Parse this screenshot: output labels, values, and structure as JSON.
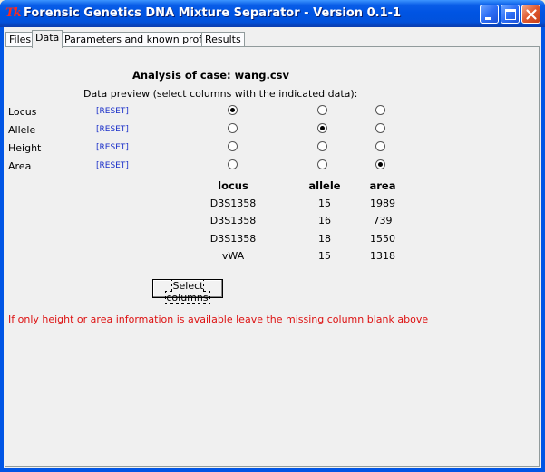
{
  "window": {
    "icon_text": "Tk",
    "title": "Forensic Genetics DNA Mixture Separator - Version 0.1-1"
  },
  "tabs": [
    {
      "label": "Files",
      "active": false
    },
    {
      "label": "Data",
      "active": true
    },
    {
      "label": "Parameters and known profiles",
      "active": false
    },
    {
      "label": "Results",
      "active": false
    }
  ],
  "data_tab": {
    "case_title": "Analysis of case: wang.csv",
    "preview_label": "Data preview (select columns with the indicated data):",
    "reset_label": "[RESET]",
    "rows": [
      {
        "label": "Locus",
        "selected_column": 1
      },
      {
        "label": "Allele",
        "selected_column": 2
      },
      {
        "label": "Height",
        "selected_column": 0
      },
      {
        "label": "Area",
        "selected_column": 3
      }
    ],
    "columns": [
      "locus",
      "allele",
      "area"
    ],
    "table": [
      [
        "D3S1358",
        "15",
        "1989"
      ],
      [
        "D3S1358",
        "16",
        "739"
      ],
      [
        "D3S1358",
        "18",
        "1550"
      ],
      [
        "vWA",
        "15",
        "1318"
      ]
    ],
    "select_button_label": "Select columns",
    "warning": "If only height or area information is available leave the missing column blank above"
  },
  "colors": {
    "titlebar": "#0054e3",
    "reset_link": "#1a2fc9",
    "warning_text": "#dd1111"
  }
}
